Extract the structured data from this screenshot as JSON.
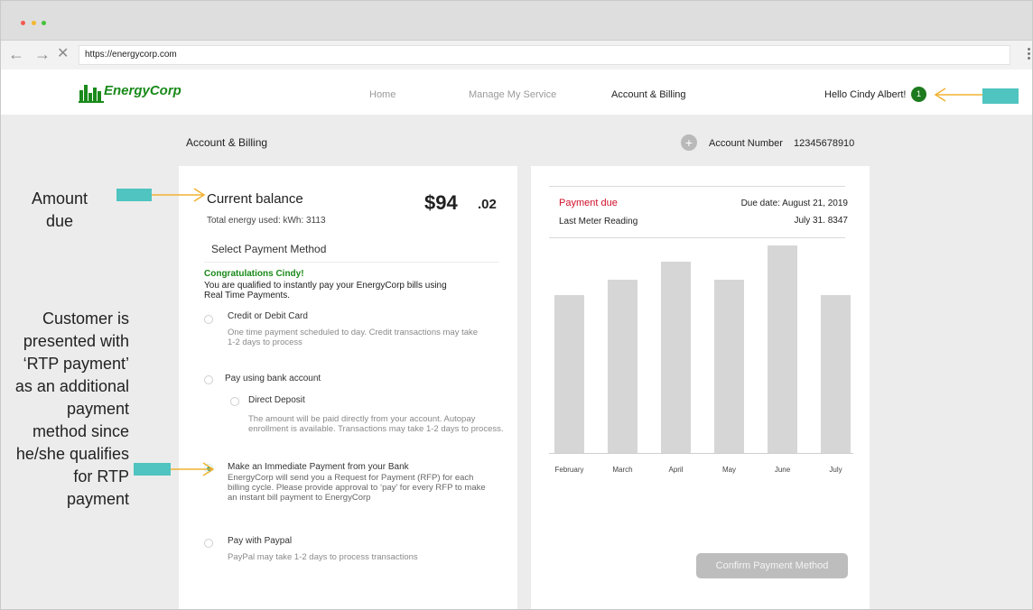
{
  "browser": {
    "url": "https://energycorp.com",
    "back_icon": "arrow-left-icon",
    "forward_icon": "arrow-right-icon",
    "stop_icon": "close-icon",
    "back_glyph": "←",
    "forward_glyph": "→",
    "stop_glyph": "✕"
  },
  "header": {
    "brand": "EnergyCorp",
    "nav": [
      "Home",
      "Manage My Service",
      "Account & Billing"
    ],
    "greeting": "Hello Cindy Albert!",
    "notification_count": "1"
  },
  "page": {
    "title": "Account & Billing",
    "account_label": "Account Number",
    "account_number": "12345678910",
    "plus_glyph": "+"
  },
  "balance": {
    "title": "Current balance",
    "amount_main": "$94",
    "amount_cents": ".02",
    "energy_used": "Total energy used: kWh: 3113",
    "select_method": "Select Payment Method",
    "congrats": "Congratulations Cindy!",
    "qualified": "You are qualified to instantly pay your EnergyCorp bills using Real Time Payments."
  },
  "options": {
    "card": {
      "title": "Credit or Debit Card",
      "desc": "One time payment scheduled to day. Credit transactions may take 1-2 days to process"
    },
    "bank": {
      "title": "Pay using bank account"
    },
    "direct_deposit": {
      "title": "Direct Deposit",
      "desc": "The amount will be paid directly from your account. Autopay enrollment is available. Transactions may take 1-2 days to process."
    },
    "rtp": {
      "title": "Make an Immediate Payment from your Bank",
      "desc": "EnergyCorp will send you a Request for Payment (RFP) for each billing cycle. Please provide approval to ‘pay’ for every RFP to make an instant bill payment to EnergyCorp"
    },
    "paypal": {
      "title": "Pay with Paypal",
      "desc": "PayPal may take 1-2 days to process transactions"
    }
  },
  "payment_due": {
    "label": "Payment due",
    "due_date": "Due date: August 21, 2019",
    "meter_label": "Last Meter Reading",
    "meter_value": "July 31. 8347"
  },
  "chart_data": {
    "type": "bar",
    "categories": [
      "February",
      "March",
      "April",
      "May",
      "June",
      "July"
    ],
    "values": [
      0.7,
      0.77,
      0.85,
      0.77,
      0.92,
      0.7
    ],
    "title": "",
    "xlabel": "",
    "ylabel": "",
    "ylim": [
      0,
      1
    ],
    "color": "#d6d6d6"
  },
  "confirm_label": "Confirm Payment Method",
  "annotations": {
    "amount": "Amount due",
    "rtp": "Customer is presented with ‘RTP payment’ as an additional payment method since he/she qualifies for RTP payment"
  },
  "colors": {
    "brand_green": "#1a8a1a",
    "accent_teal": "#4fc4c0",
    "arrow_orange": "#f0b232",
    "due_red": "#d0102a"
  }
}
